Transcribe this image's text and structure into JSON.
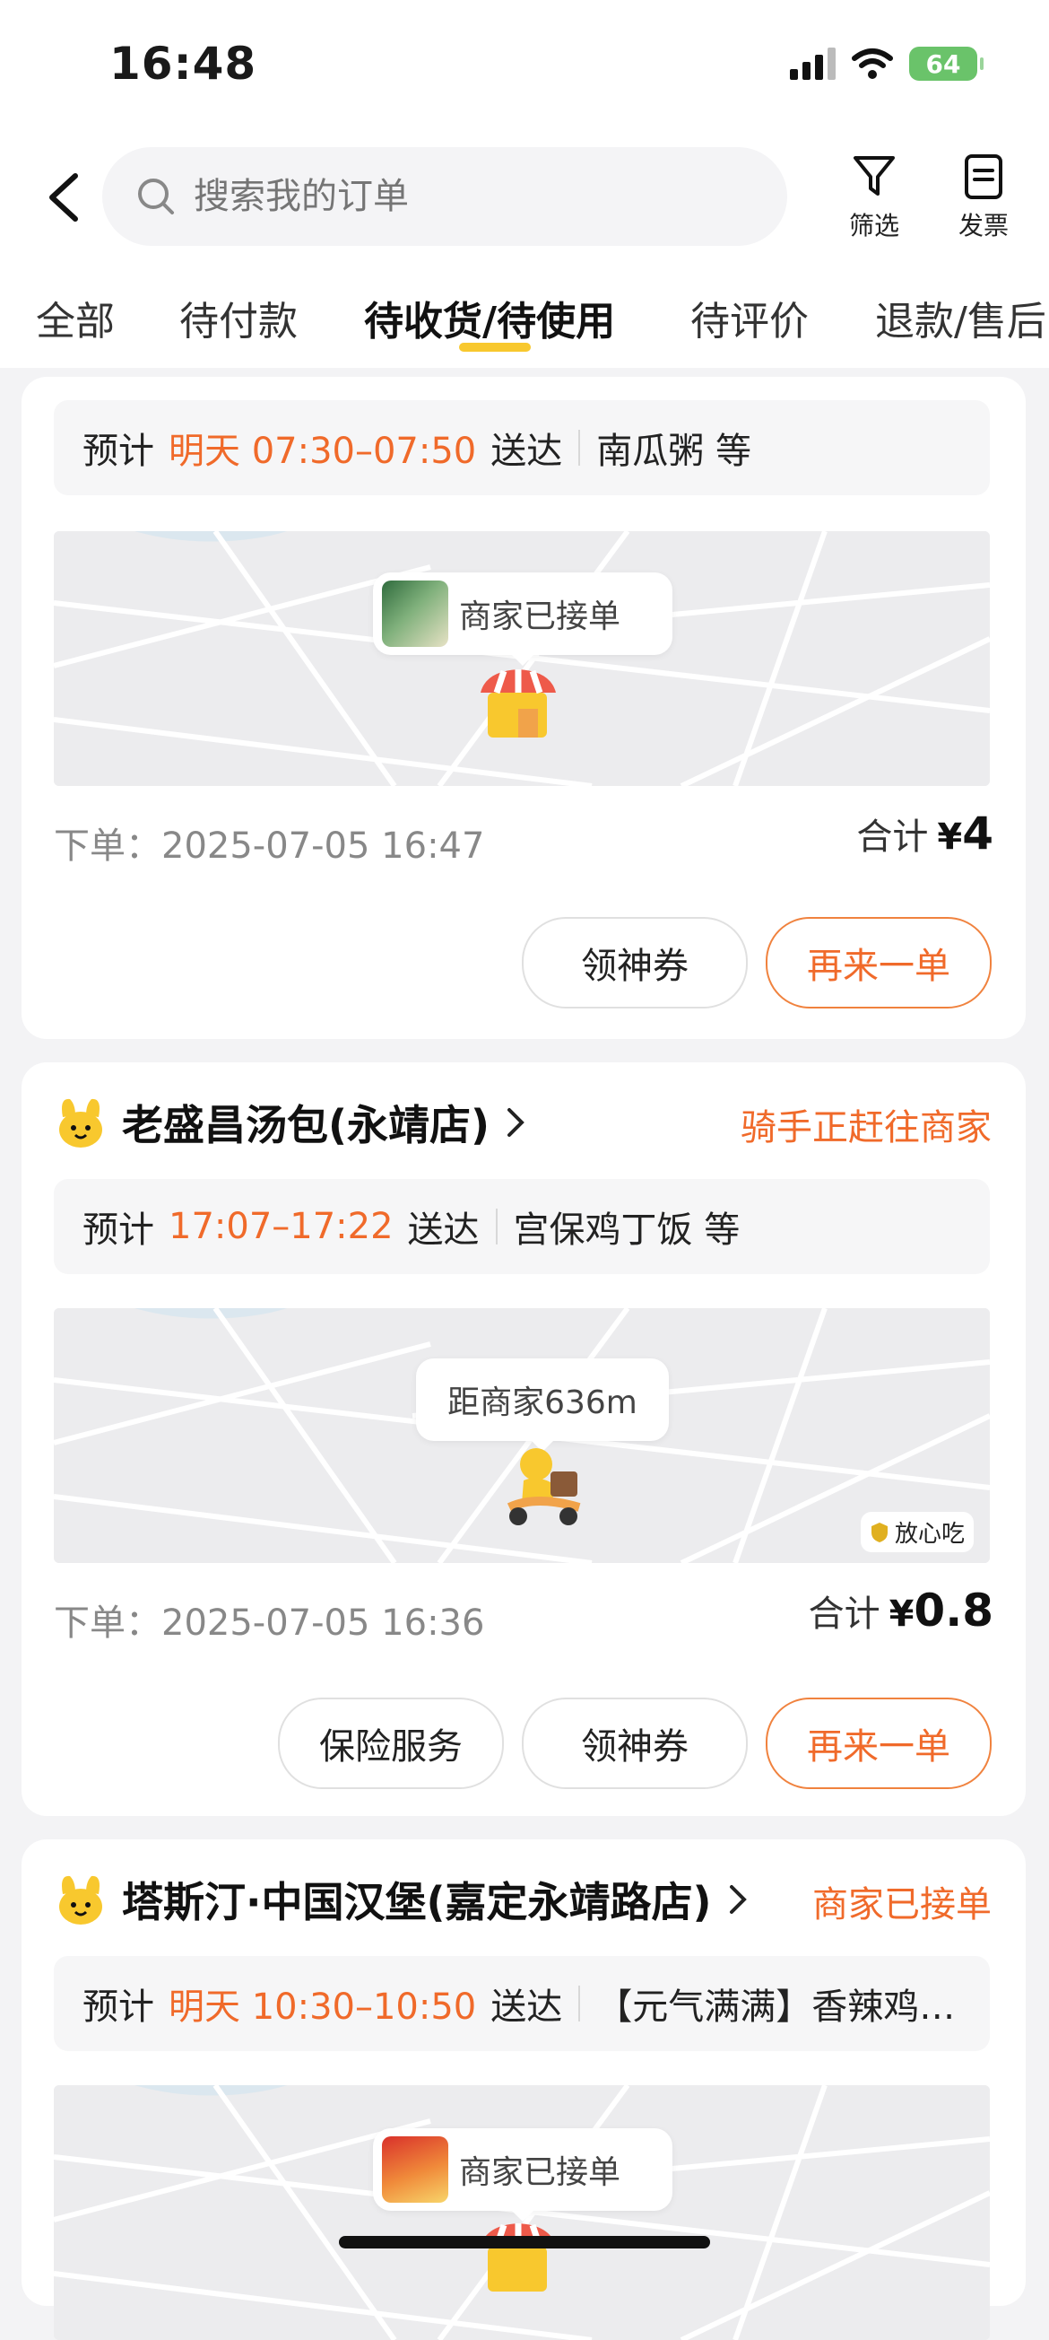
{
  "status_bar": {
    "time": "16:48",
    "battery": "64"
  },
  "header": {
    "search_placeholder": "搜索我的订单",
    "filter_label": "筛选",
    "invoice_label": "发票"
  },
  "tabs": [
    "全部",
    "待付款",
    "待收货/待使用",
    "待评价",
    "退款/售后"
  ],
  "colors": {
    "accent": "#f06a2a",
    "tab_indicator": "#f8c82e"
  },
  "orders": [
    {
      "eta_prefix": "预计",
      "eta": "明天 07:30–07:50",
      "eta_suffix": "送达",
      "items": "南瓜粥 等",
      "map_bubble": "商家已接单",
      "order_time": "下单：2025-07-05 16:47",
      "total_label": "合计",
      "currency": "¥",
      "total": "4",
      "buttons": [
        "领神券",
        "再来一单"
      ]
    },
    {
      "store": "老盛昌汤包(永靖店)",
      "status": "骑手正赶往商家",
      "eta_prefix": "预计",
      "eta": "17:07–17:22",
      "eta_suffix": "送达",
      "items": "宫保鸡丁饭 等",
      "map_bubble": "距商家636m",
      "safe_tag": "放心吃",
      "order_time": "下单：2025-07-05 16:36",
      "total_label": "合计",
      "currency": "¥",
      "total": "0.8",
      "buttons": [
        "保险服务",
        "领神券",
        "再来一单"
      ]
    },
    {
      "store": "塔斯汀·中国汉堡(嘉定永靖路店)",
      "status": "商家已接单",
      "eta_prefix": "预计",
      "eta": "明天 10:30–10:50",
      "eta_suffix": "送达",
      "items": "【元气满满】香辣鸡…",
      "map_bubble": "商家已接单"
    }
  ]
}
